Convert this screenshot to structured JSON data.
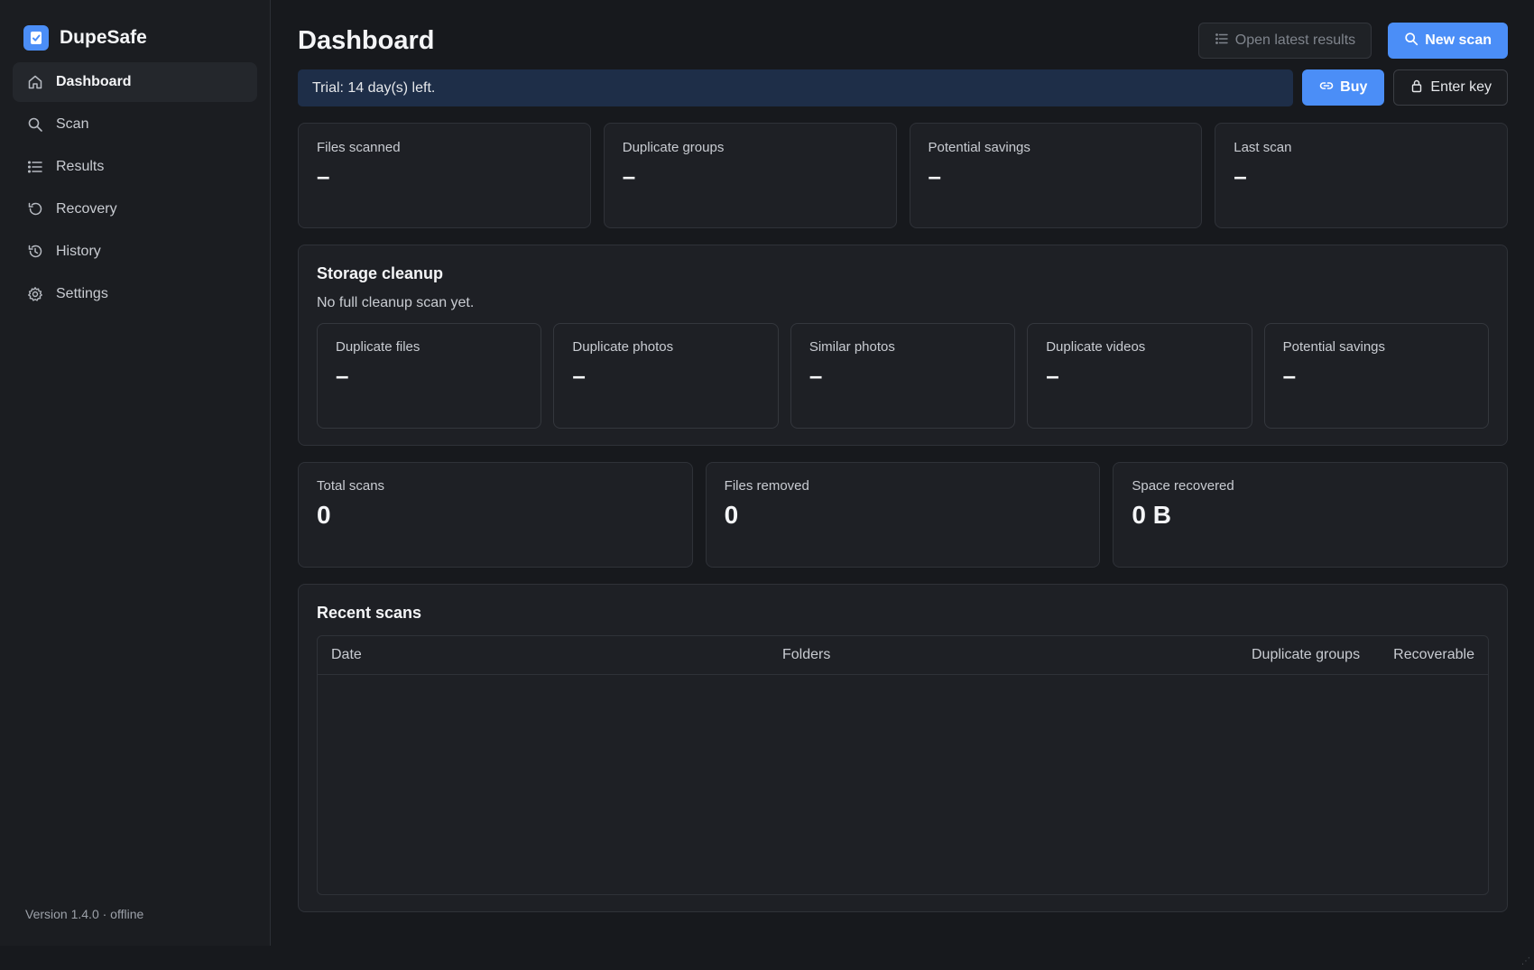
{
  "app": {
    "name": "DupeSafe",
    "version": "Version 1.4.0 · offline"
  },
  "sidebar": {
    "items": [
      {
        "label": "Dashboard",
        "icon": "home-icon",
        "active": true
      },
      {
        "label": "Scan",
        "icon": "search-icon",
        "active": false
      },
      {
        "label": "Results",
        "icon": "list-icon",
        "active": false
      },
      {
        "label": "Recovery",
        "icon": "undo-icon",
        "active": false
      },
      {
        "label": "History",
        "icon": "history-icon",
        "active": false
      },
      {
        "label": "Settings",
        "icon": "gear-icon",
        "active": false
      }
    ]
  },
  "header": {
    "title": "Dashboard",
    "open_latest_label": "Open latest results",
    "new_scan_label": "New scan"
  },
  "trial": {
    "message": "Trial: 14 day(s) left.",
    "buy_label": "Buy",
    "enter_key_label": "Enter key"
  },
  "stats": [
    {
      "label": "Files scanned",
      "value": "–"
    },
    {
      "label": "Duplicate groups",
      "value": "–"
    },
    {
      "label": "Potential savings",
      "value": "–"
    },
    {
      "label": "Last scan",
      "value": "–"
    }
  ],
  "cleanup": {
    "title": "Storage cleanup",
    "subtitle": "No full cleanup scan yet.",
    "items": [
      {
        "label": "Duplicate files",
        "value": "–"
      },
      {
        "label": "Duplicate photos",
        "value": "–"
      },
      {
        "label": "Similar photos",
        "value": "–"
      },
      {
        "label": "Duplicate videos",
        "value": "–"
      },
      {
        "label": "Potential savings",
        "value": "–"
      }
    ]
  },
  "totals": [
    {
      "label": "Total scans",
      "value": "0"
    },
    {
      "label": "Files removed",
      "value": "0"
    },
    {
      "label": "Space recovered",
      "value": "0 B"
    }
  ],
  "recent": {
    "title": "Recent scans",
    "columns": [
      "Date",
      "Folders",
      "Duplicate groups",
      "Recoverable"
    ],
    "rows": []
  },
  "colors": {
    "accent": "#4b8ef7",
    "background": "#17191d",
    "sidebar": "#1b1d21",
    "card": "#1e2025",
    "trial_banner": "#1e2e48"
  }
}
